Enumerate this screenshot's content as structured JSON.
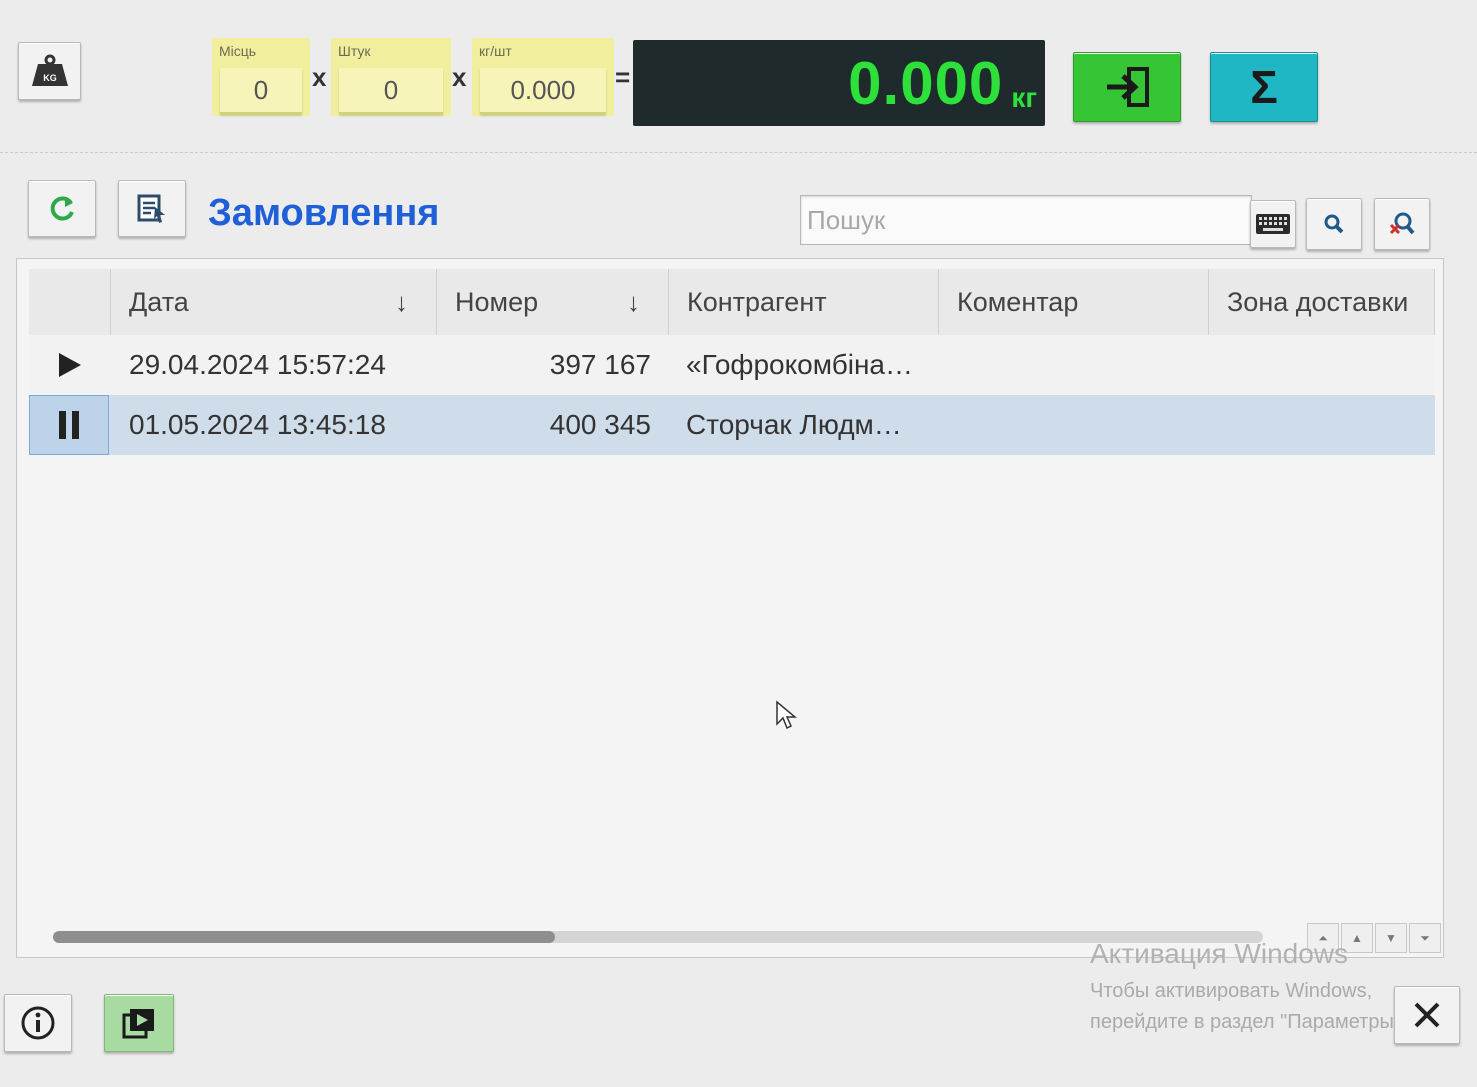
{
  "toolbar": {
    "scale_icon_text": "KG",
    "places_label": "Місць",
    "places_value": "0",
    "pieces_label": "Штук",
    "pieces_value": "0",
    "kgpc_label": "кг/шт",
    "kgpc_value": "0.000",
    "op_multiply": "x",
    "op_equals": "=",
    "weight_value": "0.000",
    "weight_unit": "кг",
    "sum_symbol": "Σ"
  },
  "header": {
    "title": "Замовлення",
    "search_placeholder": "Пошук"
  },
  "table": {
    "columns": [
      {
        "label": "Дата",
        "sort": "↓"
      },
      {
        "label": "Номер",
        "sort": "↓"
      },
      {
        "label": "Контрагент"
      },
      {
        "label": "Коментар"
      },
      {
        "label": "Зона доставки"
      }
    ],
    "rows": [
      {
        "state": "play",
        "date": "29.04.2024 15:57:24",
        "number": "397 167",
        "counterparty": "«Гофрокомбіна…",
        "comment": "",
        "zone": ""
      },
      {
        "state": "pause",
        "date": "01.05.2024 13:45:18",
        "number": "400 345",
        "counterparty": "Сторчак Людм…",
        "comment": "",
        "zone": ""
      }
    ]
  },
  "colors": {
    "accent_blue": "#1f5fd8",
    "green_button": "#36c534",
    "teal_button": "#1fb7c4",
    "display_bg": "#1f2a2c",
    "display_text": "#2ee03a",
    "counter_bg": "#f1ef9e",
    "selected_row": "#cfdcea"
  },
  "watermark": {
    "line1": "Активация Windows",
    "line2": "Чтобы активировать Windows,",
    "line3": "перейдите в раздел \"Параметры\""
  }
}
